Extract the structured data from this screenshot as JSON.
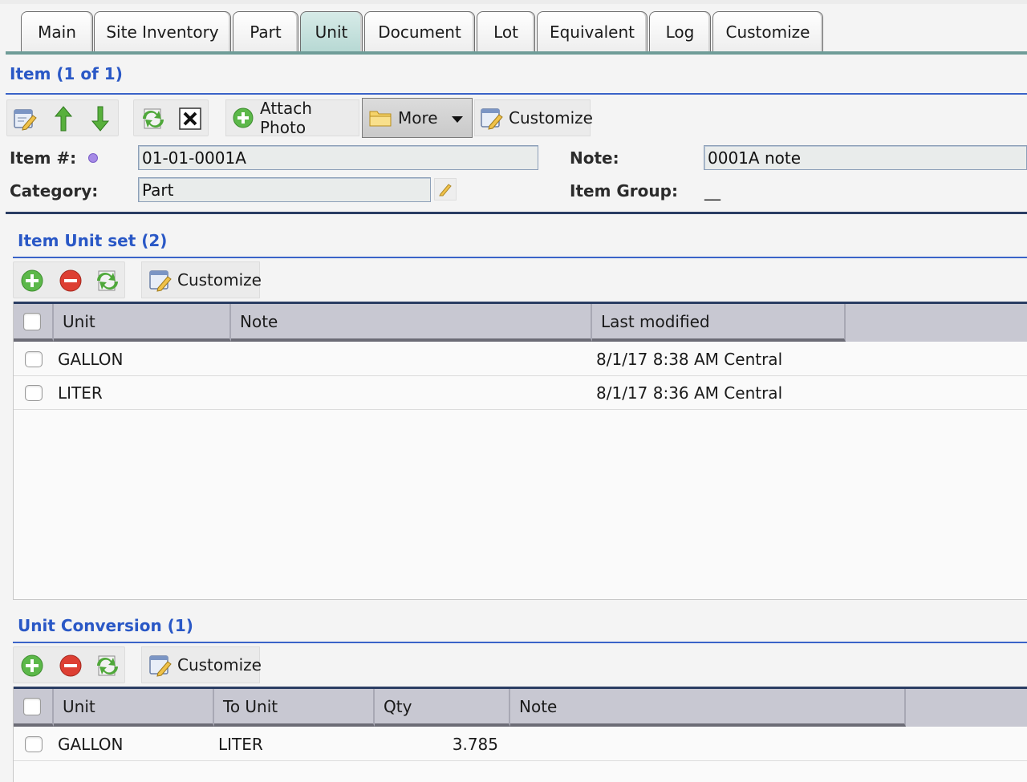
{
  "tabs": [
    {
      "label": "Main"
    },
    {
      "label": "Site Inventory"
    },
    {
      "label": "Part"
    },
    {
      "label": "Unit"
    },
    {
      "label": "Document"
    },
    {
      "label": "Lot"
    },
    {
      "label": "Equivalent"
    },
    {
      "label": "Log"
    },
    {
      "label": "Customize"
    }
  ],
  "active_tab": "Unit",
  "item": {
    "title": "Item (1 of 1)",
    "toolbar": {
      "attach_photo_label": "Attach Photo",
      "more_label": "More",
      "customize_label": "Customize"
    },
    "fields": {
      "item_number_label": "Item #:",
      "item_number_value": "01-01-0001A",
      "category_label": "Category:",
      "category_value": "Part",
      "note_label": "Note:",
      "note_value": "0001A note",
      "item_group_label": "Item Group:",
      "item_group_value": "__"
    }
  },
  "unit_set": {
    "title": "Item Unit set (2)",
    "customize_label": "Customize",
    "columns": [
      "Unit",
      "Note",
      "Last modified"
    ],
    "rows": [
      {
        "unit": "GALLON",
        "note": "",
        "last_modified": "8/1/17 8:38 AM Central"
      },
      {
        "unit": "LITER",
        "note": "",
        "last_modified": "8/1/17 8:36 AM Central"
      }
    ]
  },
  "unit_conversion": {
    "title": "Unit Conversion (1)",
    "customize_label": "Customize",
    "columns": [
      "Unit",
      "To Unit",
      "Qty",
      "Note"
    ],
    "rows": [
      {
        "unit": "GALLON",
        "to_unit": "LITER",
        "qty": "3.785",
        "note": ""
      }
    ]
  },
  "colors": {
    "accent_blue": "#2a58c6",
    "active_tab": "#b6d8d3",
    "header_bg": "#c8c8d2",
    "add_green": "#3aa83a",
    "remove_red": "#d8362a"
  }
}
